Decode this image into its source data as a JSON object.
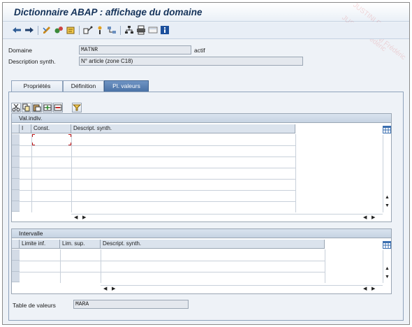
{
  "window": {
    "title": "Dictionnaire ABAP : affichage du domaine"
  },
  "watermark": {
    "text": "JUSTINI Frédéric"
  },
  "toolbar": {
    "icons": [
      "back-arrow-icon",
      "forward-arrow-icon",
      "edit-toggle-icon",
      "check-icon",
      "activate-icon",
      "where-used-icon",
      "object-list-icon",
      "navigation-window-icon",
      "hierarchy-icon",
      "print-icon",
      "display-object-icon",
      "info-icon"
    ]
  },
  "header": {
    "domain_label": "Domaine",
    "domain_value": "MATNR",
    "status": "actif",
    "desc_label": "Description synth.",
    "desc_value": "N° article (zone C18)"
  },
  "tabs": [
    {
      "label": "Propriétés"
    },
    {
      "label": "Définition"
    },
    {
      "label": "Pl. valeurs"
    }
  ],
  "single_values": {
    "title": "Val.indiv.",
    "columns": [
      "I",
      "Const.",
      "Descript. synth."
    ]
  },
  "intervals": {
    "title": "Intervalle",
    "columns": [
      "Limite inf.",
      "Lim. sup.",
      "Descript. synth."
    ]
  },
  "value_table": {
    "label": "Table de valeurs",
    "value": "MARA"
  }
}
